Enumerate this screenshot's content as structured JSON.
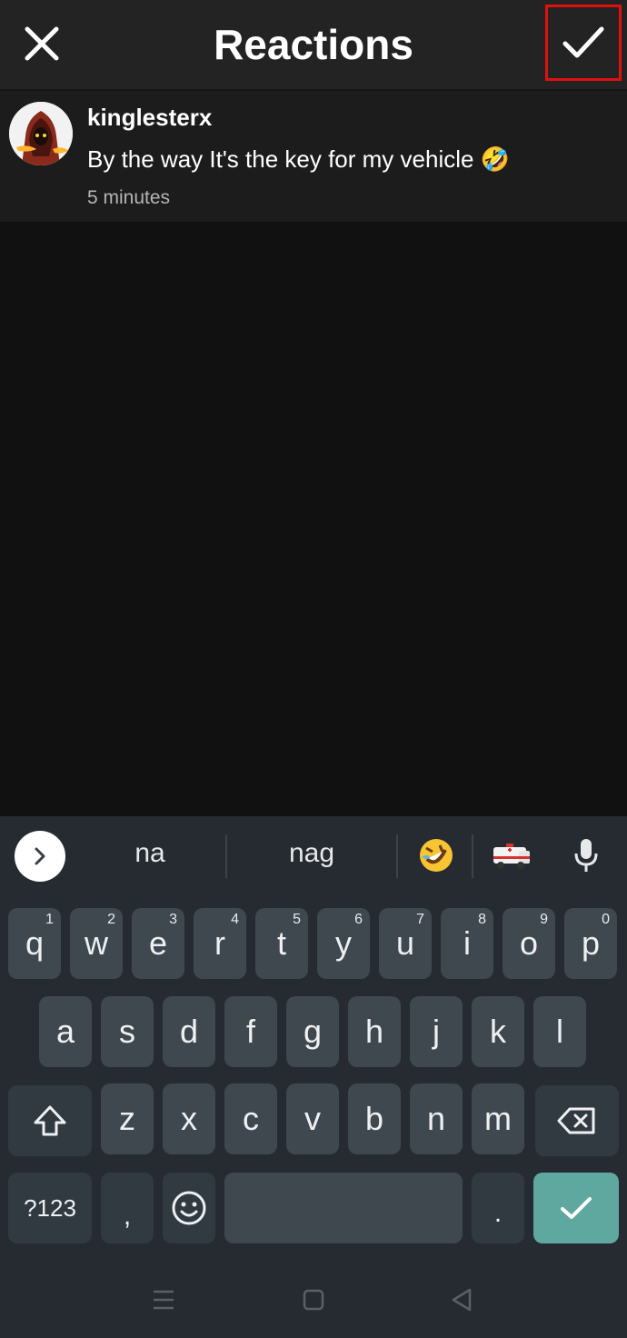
{
  "header": {
    "title": "Reactions",
    "close_icon": "close-icon",
    "confirm_icon": "checkmark-icon"
  },
  "comment": {
    "username": "kinglesterx",
    "text": "By the way It's the key for my vehicle 🤣",
    "timestamp": "5 minutes",
    "avatar_icon": "avatar"
  },
  "keyboard": {
    "suggestions": [
      "na",
      "nag"
    ],
    "suggestion_icons": [
      "rolling-on-floor-laughing-emoji-icon",
      "ambulance-emoji-icon",
      "microphone-icon"
    ],
    "row1": [
      {
        "k": "q",
        "h": "1"
      },
      {
        "k": "w",
        "h": "2"
      },
      {
        "k": "e",
        "h": "3"
      },
      {
        "k": "r",
        "h": "4"
      },
      {
        "k": "t",
        "h": "5"
      },
      {
        "k": "y",
        "h": "6"
      },
      {
        "k": "u",
        "h": "7"
      },
      {
        "k": "i",
        "h": "8"
      },
      {
        "k": "o",
        "h": "9"
      },
      {
        "k": "p",
        "h": "0"
      }
    ],
    "row2": [
      "a",
      "s",
      "d",
      "f",
      "g",
      "h",
      "j",
      "k",
      "l"
    ],
    "row3": [
      "z",
      "x",
      "c",
      "v",
      "b",
      "n",
      "m"
    ],
    "symbols_label": "?123",
    "comma_label": ",",
    "period_label": ".",
    "accent_color": "#5ea8a0"
  }
}
